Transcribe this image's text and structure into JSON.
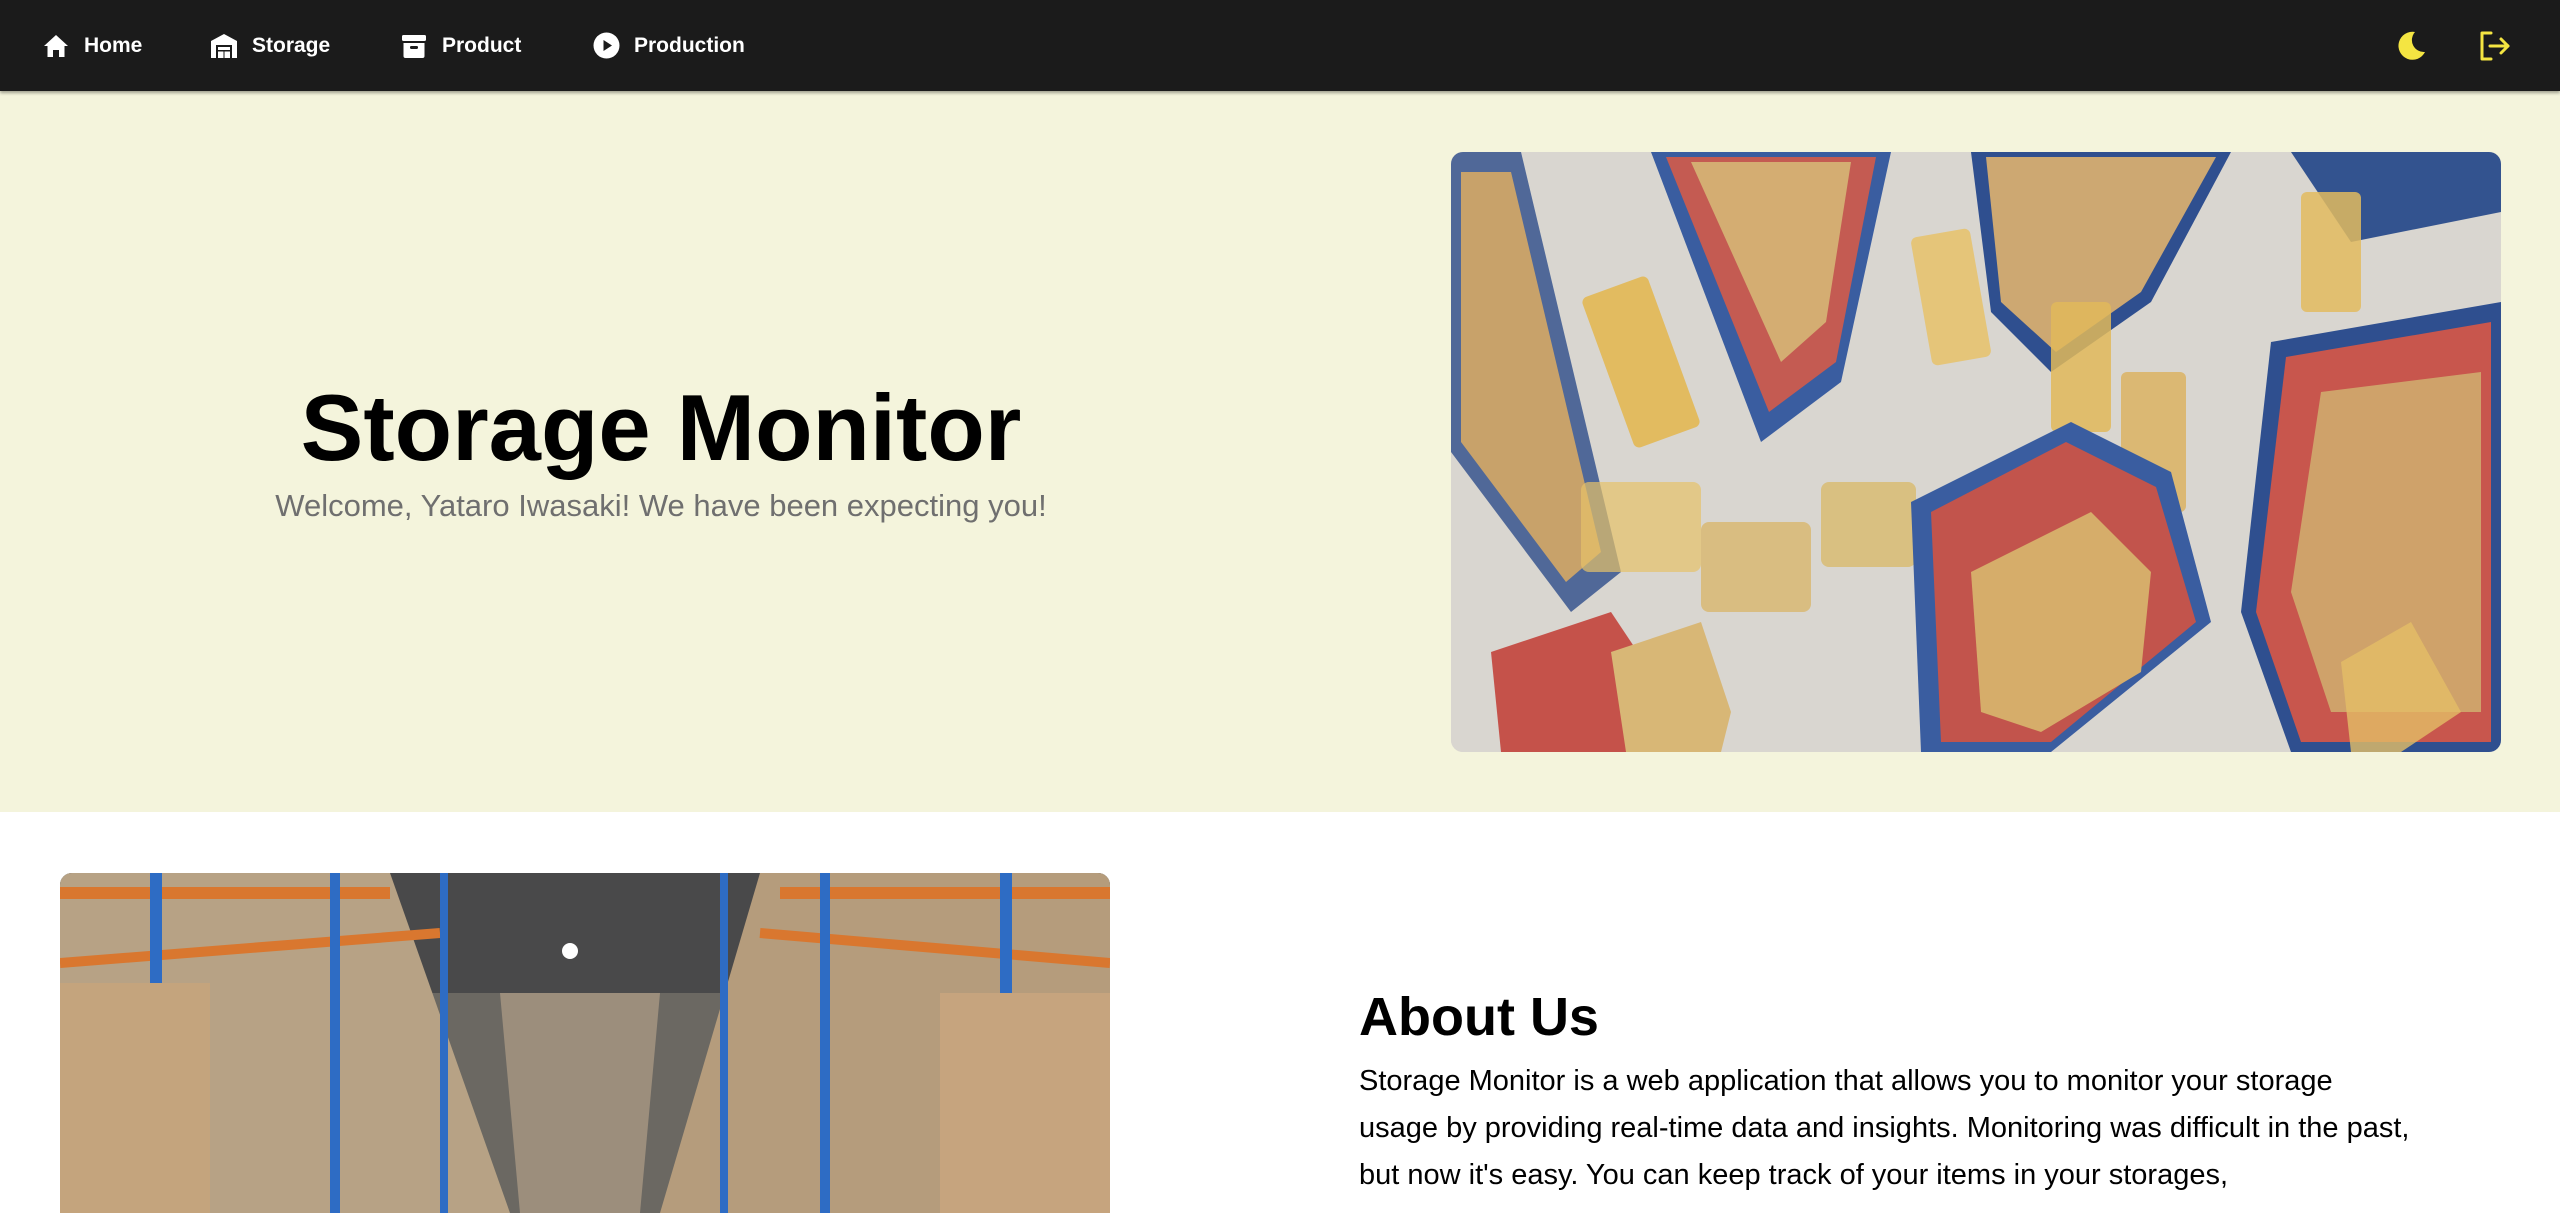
{
  "nav": {
    "items": [
      {
        "label": "Home",
        "icon": "home-icon"
      },
      {
        "label": "Storage",
        "icon": "warehouse-icon"
      },
      {
        "label": "Product",
        "icon": "archive-box-icon"
      },
      {
        "label": "Production",
        "icon": "play-circle-icon"
      }
    ],
    "right_icons": [
      "moon-icon",
      "logout-icon"
    ],
    "accent_color": "#f4e542",
    "background": "#1b1b1b"
  },
  "hero": {
    "title": "Storage Monitor",
    "subtitle": "Welcome, Yataro Iwasaki! We have been expecting you!",
    "background": "#f4f4dc",
    "image": "warehouse-aerial-photo"
  },
  "about": {
    "title": "About Us",
    "body": "Storage Monitor is a web application that allows you to monitor your storage usage by providing real-time data and insights. Monitoring was difficult in the past, but now it's easy. You can keep track of your items in your storages,",
    "image": "warehouse-aisle-photo"
  }
}
